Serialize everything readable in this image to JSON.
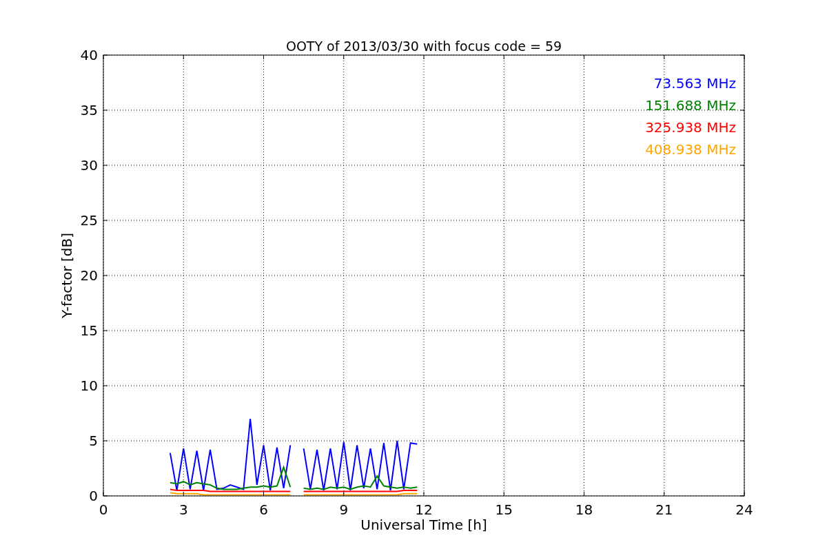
{
  "chart_data": {
    "type": "line",
    "title": "OOTY of 2013/03/30 with focus code = 59",
    "xlabel": "Universal Time [h]",
    "ylabel": "Y-factor [dB]",
    "x": [
      2.5,
      2.75,
      3,
      3.25,
      3.5,
      3.75,
      4,
      4.25,
      4.5,
      4.75,
      5,
      5.25,
      5.5,
      5.75,
      6,
      6.25,
      6.5,
      6.75,
      7,
      7.25,
      7.5,
      7.75,
      8,
      8.25,
      8.5,
      8.75,
      9,
      9.25,
      9.5,
      9.75,
      10,
      10.25,
      10.5,
      10.75,
      11,
      11.25,
      11.5,
      11.75
    ],
    "series": [
      {
        "name": "73.563 MHz",
        "color": "#0000ff",
        "values": [
          3.9,
          0.5,
          4.3,
          0.6,
          4.1,
          0.5,
          4.2,
          0.6,
          0.7,
          1.0,
          0.8,
          0.6,
          7.0,
          1.0,
          4.6,
          0.5,
          4.4,
          0.7,
          4.6,
          null,
          4.3,
          0.6,
          4.2,
          0.5,
          4.3,
          0.6,
          4.9,
          0.5,
          4.6,
          0.7,
          4.3,
          0.6,
          4.8,
          0.5,
          5.0,
          0.6,
          4.8,
          4.7
        ]
      },
      {
        "name": "151.688 MHz",
        "color": "#008000",
        "values": [
          1.2,
          1.1,
          1.3,
          1.0,
          1.2,
          1.1,
          1.0,
          0.7,
          0.6,
          0.6,
          0.6,
          0.7,
          0.8,
          0.8,
          0.9,
          0.8,
          0.9,
          2.6,
          0.8,
          null,
          0.7,
          0.6,
          0.7,
          0.6,
          0.8,
          0.7,
          0.8,
          0.6,
          0.8,
          0.9,
          0.8,
          1.8,
          0.9,
          0.8,
          0.7,
          0.8,
          0.7,
          0.8
        ]
      },
      {
        "name": "325.938 MHz",
        "color": "#ff0000",
        "values": [
          0.6,
          0.5,
          0.5,
          0.5,
          0.5,
          0.5,
          0.4,
          0.4,
          0.4,
          0.4,
          0.4,
          0.4,
          0.4,
          0.4,
          0.4,
          0.4,
          0.4,
          0.4,
          0.4,
          null,
          0.4,
          0.4,
          0.4,
          0.4,
          0.4,
          0.4,
          0.4,
          0.4,
          0.4,
          0.4,
          0.4,
          0.4,
          0.4,
          0.4,
          0.4,
          0.5,
          0.5,
          0.5
        ]
      },
      {
        "name": "408.938 MHz",
        "color": "#ffa500",
        "values": [
          0.3,
          0.2,
          0.2,
          0.2,
          0.2,
          0.1,
          0.1,
          0.1,
          0.1,
          0.1,
          0.1,
          0.1,
          0.1,
          0.1,
          0.1,
          0.1,
          0.1,
          0.1,
          0.1,
          null,
          0.1,
          0.1,
          0.1,
          0.1,
          0.1,
          0.1,
          0.1,
          0.1,
          0.1,
          0.1,
          0.1,
          0.1,
          0.1,
          0.1,
          0.1,
          0.2,
          0.2,
          0.2
        ]
      }
    ],
    "xlim": [
      0,
      24
    ],
    "grid": true,
    "ylim": [
      0,
      40
    ],
    "xticks": [
      0,
      3,
      6,
      9,
      12,
      15,
      18,
      21,
      24
    ],
    "yticks": [
      0,
      5,
      10,
      15,
      20,
      25,
      30,
      35,
      40
    ]
  }
}
